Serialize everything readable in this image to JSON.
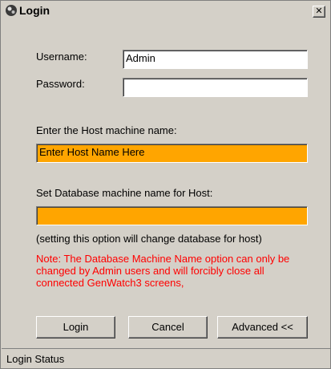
{
  "window": {
    "title": "Login",
    "close_glyph": "✕"
  },
  "form": {
    "username_label": "Username:",
    "username_value": "Admin",
    "password_label": "Password:",
    "password_value": "",
    "host_label": "Enter the Host machine name:",
    "host_value": "Enter Host Name Here",
    "db_label": "Set Database machine name for Host:",
    "db_value": "",
    "db_hint": "(setting this option will change database for host)",
    "note": "Note: The Database Machine Name option can only be changed by Admin users and will forcibly close all connected GenWatch3 screens,"
  },
  "buttons": {
    "login": "Login",
    "cancel": "Cancel",
    "advanced": "Advanced <<"
  },
  "status": {
    "text": "Login Status"
  },
  "colors": {
    "highlight": "#ffa500",
    "note": "#ff0000"
  }
}
